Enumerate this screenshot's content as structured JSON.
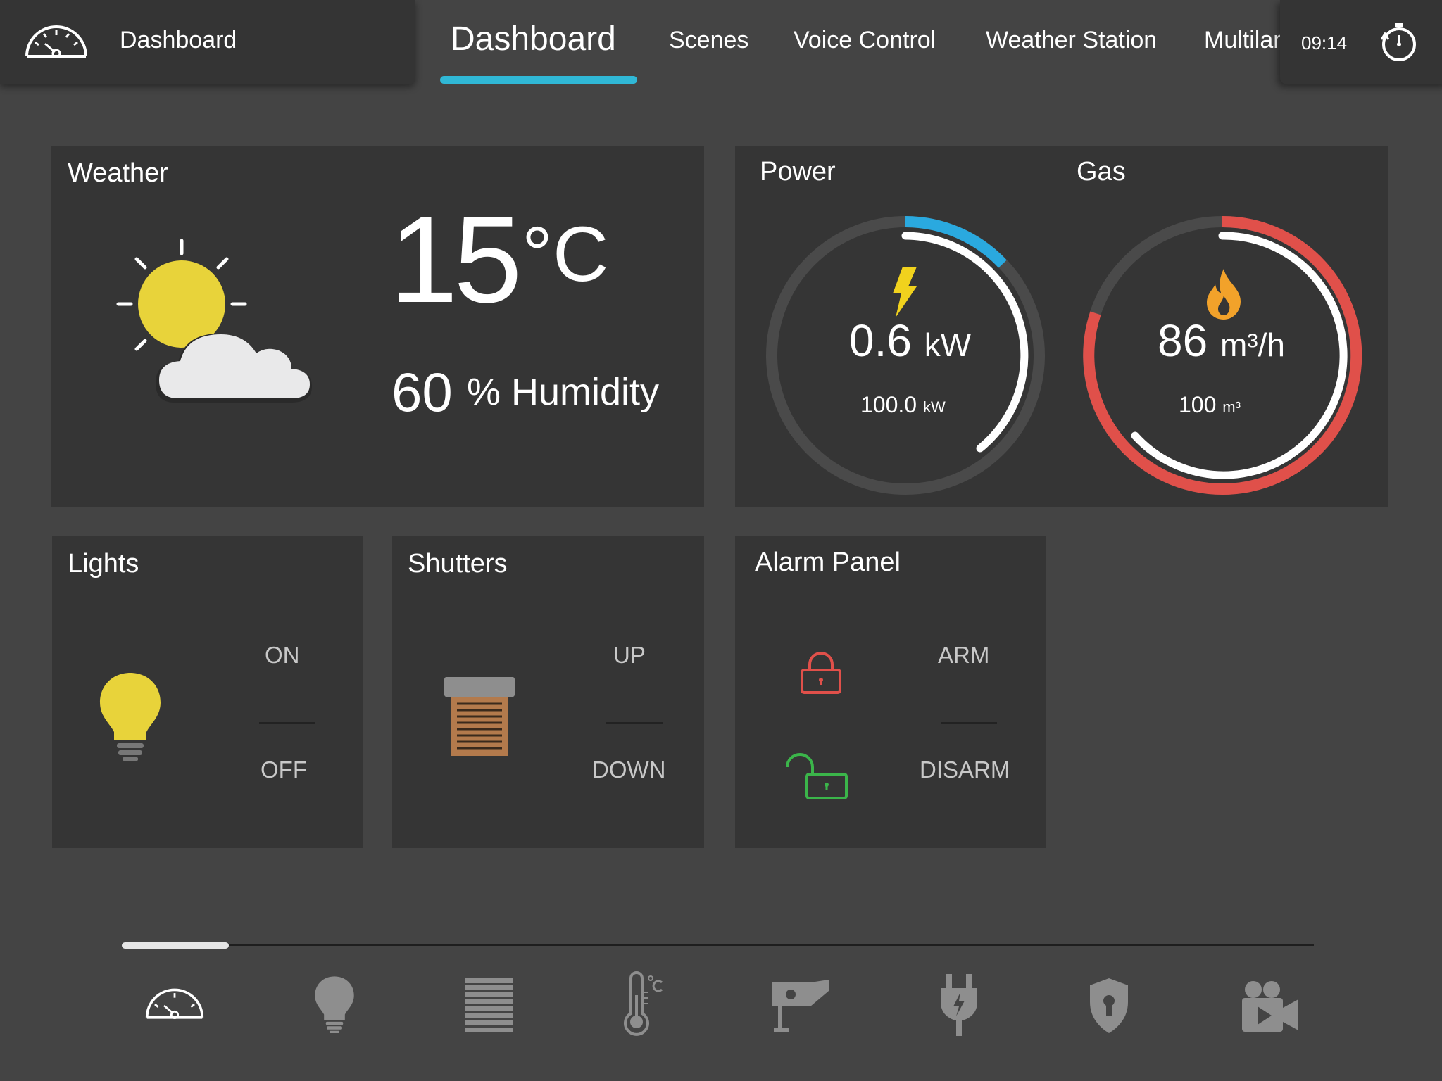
{
  "header": {
    "brand_title": "Dashboard",
    "brand_icon": "speedometer-icon",
    "tabs": [
      {
        "label": "Dashboard",
        "active": true
      },
      {
        "label": "Scenes"
      },
      {
        "label": "Voice Control"
      },
      {
        "label": "Weather Station"
      },
      {
        "label": "Multilar"
      }
    ],
    "time": "09:14",
    "timer_icon": "stopwatch-icon",
    "accent_color": "#30b8d6"
  },
  "weather": {
    "title": "Weather",
    "icon": "partly-cloudy-icon",
    "temperature": "15",
    "temperature_unit": "°C",
    "humidity": "60",
    "humidity_unit": "% Humidity"
  },
  "power": {
    "title": "Power",
    "value": "0.6",
    "unit": "kW",
    "max": "100.0",
    "max_unit": "kW",
    "icon": "lightning-icon",
    "accent_color": "#2aa9df"
  },
  "gas": {
    "title": "Gas",
    "value": "86",
    "unit": "m³/h",
    "max": "100",
    "max_unit": "m³",
    "icon": "flame-icon",
    "accent_color": "#e0504a"
  },
  "lights": {
    "title": "Lights",
    "on_label": "ON",
    "off_label": "OFF",
    "icon": "lightbulb-icon"
  },
  "shutters": {
    "title": "Shutters",
    "up_label": "UP",
    "down_label": "DOWN",
    "icon": "shutter-icon"
  },
  "alarm": {
    "title": "Alarm Panel",
    "arm_label": "ARM",
    "disarm_label": "DISARM",
    "locked_icon": "lock-closed-icon",
    "unlocked_icon": "lock-open-icon"
  },
  "bottom_nav": {
    "items": [
      {
        "icon": "speedometer-icon",
        "active": true
      },
      {
        "icon": "lightbulb-icon"
      },
      {
        "icon": "shutter-icon"
      },
      {
        "icon": "thermometer-icon"
      },
      {
        "icon": "camera-icon"
      },
      {
        "icon": "power-plug-icon"
      },
      {
        "icon": "security-shield-icon"
      },
      {
        "icon": "video-camera-icon"
      }
    ]
  }
}
